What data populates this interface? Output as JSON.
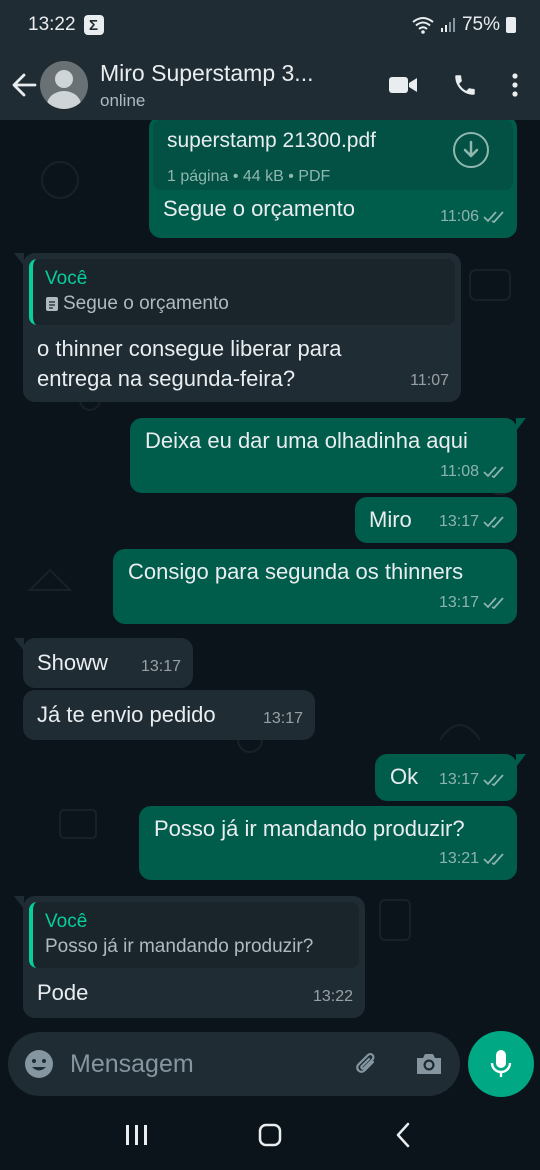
{
  "status_bar": {
    "time": "13:22",
    "battery": "75%"
  },
  "header": {
    "contact_name": "Miro Superstamp 3...",
    "presence": "online"
  },
  "messages": [
    {
      "direction": "out",
      "document": {
        "filename": "superstamp 21300.pdf",
        "info": "1 página • 44 kB • PDF"
      },
      "text": "Segue o orçamento",
      "time": "11:06",
      "status": "read"
    },
    {
      "direction": "in",
      "quote": {
        "author": "Você",
        "text": "Segue o orçamento",
        "icon": "document-icon"
      },
      "text_line1": "o thinner consegue liberar para",
      "text_line2": "entrega na segunda-feira?",
      "time": "11:07"
    },
    {
      "direction": "out",
      "text": "Deixa eu dar uma olhadinha aqui",
      "time": "11:08",
      "status": "read"
    },
    {
      "direction": "out",
      "text": "Miro",
      "time": "13:17",
      "status": "read"
    },
    {
      "direction": "out",
      "text": "Consigo para segunda os thinners",
      "time": "13:17",
      "status": "read"
    },
    {
      "direction": "in",
      "text": "Showw",
      "time": "13:17"
    },
    {
      "direction": "in",
      "text": "Já te envio pedido",
      "time": "13:17"
    },
    {
      "direction": "out",
      "text": "Ok",
      "time": "13:17",
      "status": "read"
    },
    {
      "direction": "out",
      "text": "Posso já ir mandando produzir?",
      "time": "13:21",
      "status": "read"
    },
    {
      "direction": "in",
      "quote": {
        "author": "Você",
        "text": "Posso já ir mandando produzir?"
      },
      "text": "Pode",
      "time": "13:22"
    }
  ],
  "input": {
    "placeholder": "Mensagem"
  },
  "colors": {
    "outgoing": "#005c4b",
    "incoming": "#1f2c34",
    "accent": "#00a884",
    "background": "#0b141a",
    "header": "#1f2c34"
  }
}
